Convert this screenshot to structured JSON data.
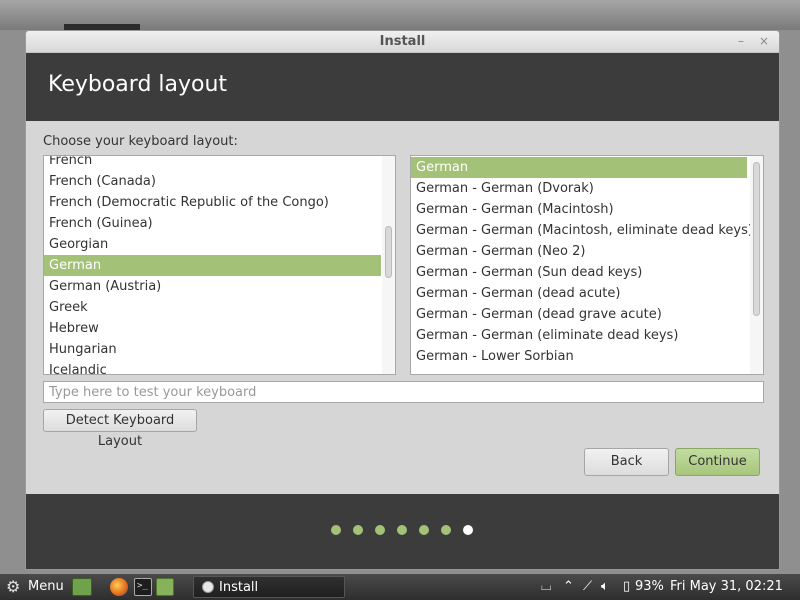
{
  "window": {
    "title": "Install",
    "minimize_glyph": "–",
    "close_glyph": "×"
  },
  "header": {
    "title": "Keyboard layout"
  },
  "layout_prompt": "Choose your keyboard layout:",
  "layouts": {
    "selected": "German",
    "items": [
      "French",
      "French (Canada)",
      "French (Democratic Republic of the Congo)",
      "French (Guinea)",
      "Georgian",
      "German",
      "German (Austria)",
      "Greek",
      "Hebrew",
      "Hungarian",
      "Icelandic"
    ]
  },
  "variants": {
    "selected": "German",
    "items": [
      "German",
      "German - German (Dvorak)",
      "German - German (Macintosh)",
      "German - German (Macintosh, eliminate dead keys)",
      "German - German (Neo 2)",
      "German - German (Sun dead keys)",
      "German - German (dead acute)",
      "German - German (dead grave acute)",
      "German - German (eliminate dead keys)",
      "German - Lower Sorbian"
    ]
  },
  "test_input": {
    "placeholder": "Type here to test your keyboard",
    "value": ""
  },
  "buttons": {
    "detect": "Detect Keyboard Layout",
    "back": "Back",
    "continue": "Continue"
  },
  "progress": {
    "total_steps": 7,
    "current_step": 7
  },
  "colors": {
    "accent": "#a3c278",
    "header_bg": "#3c3c3c",
    "window_bg": "#d6d6d6"
  },
  "taskbar": {
    "menu_label": "Menu",
    "menu_icon": "gear-icon",
    "task_label": "Install",
    "battery": "93%",
    "clock": "Fri May 31, 02:21",
    "icons": {
      "keyboard": "keyboard-icon",
      "up": "chevron-up-icon",
      "network": "network-icon",
      "volume": "volume-icon",
      "battery": "battery-icon"
    }
  }
}
